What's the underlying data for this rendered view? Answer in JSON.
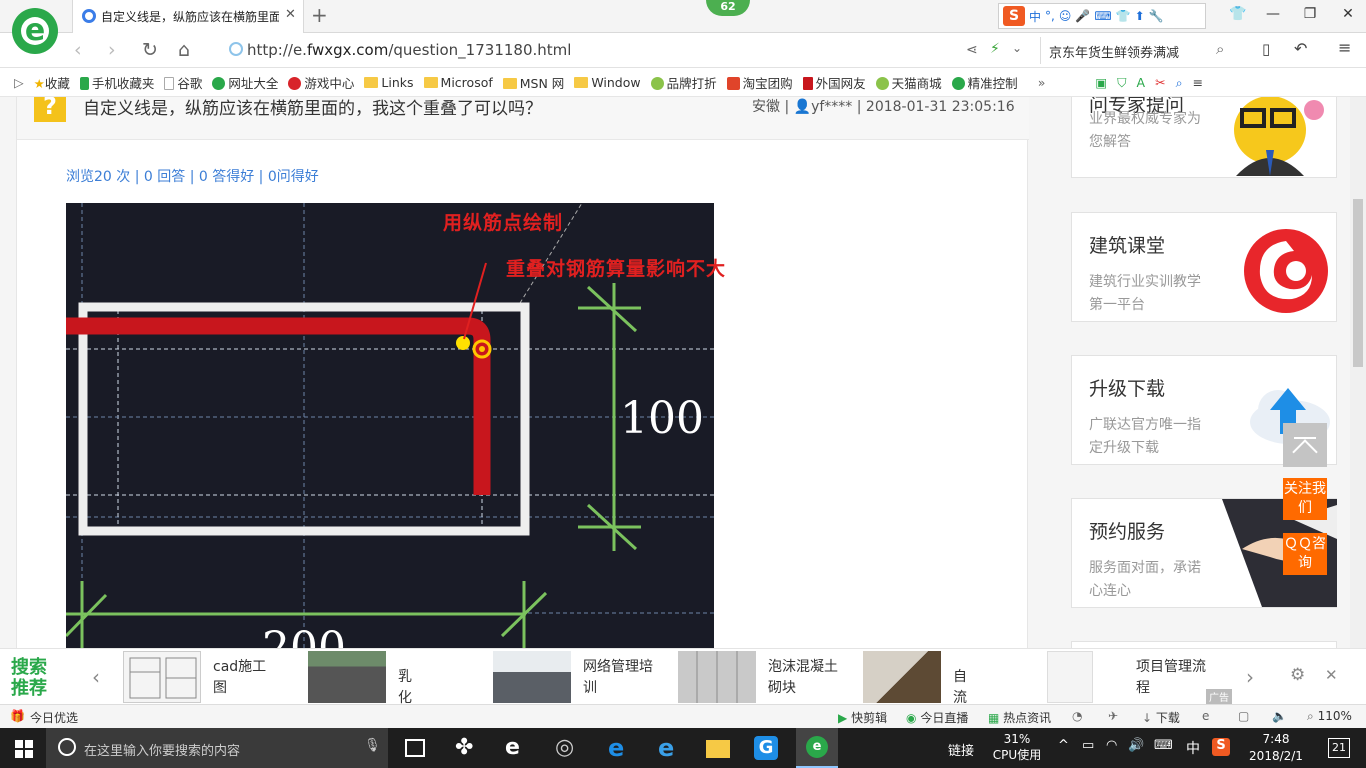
{
  "tab": {
    "title": "自定义线是，纵筋应该在横筋里面"
  },
  "badge": "62",
  "sogou": {
    "items": [
      "中",
      "°,",
      "☺",
      "🎤",
      "⌨",
      "👕",
      "⬆",
      "🔧"
    ]
  },
  "address": {
    "url_prefix": "http://e.",
    "url_domain": "fwxgx.com",
    "url_path": "/question_1731180.html",
    "search_text": "京东年货生鲜领券满减"
  },
  "bookmarks": [
    "收藏",
    "手机收藏夹",
    "谷歌",
    "网址大全",
    "游戏中心",
    "Links",
    "Microsof",
    "MSN 网",
    "Window",
    "品牌打折",
    "淘宝团购",
    "外国网友",
    "天猫商城",
    "精准控制"
  ],
  "question": {
    "icon": "?",
    "title": "自定义线是，纵筋应该在横筋里面的，我这个重叠了可以吗？",
    "meta_province": "安徽",
    "meta_user": "yf****",
    "meta_date": "2018-01-31 23:05:16",
    "stats": "浏览20 次 | 0 回答 | 0 答得好 | 0问得好"
  },
  "cad": {
    "label1": "用纵筋点绘制",
    "label2": "重叠对钢筋算量影响不大",
    "dim_value": "100",
    "dim_bottom": "200"
  },
  "cards": [
    {
      "title": "问专家提问",
      "desc": "业界最权威专家为您解答"
    },
    {
      "title": "建筑课堂",
      "desc": "建筑行业实训教学第一平台"
    },
    {
      "title": "升级下载",
      "desc": "广联达官方唯一指定升级下载"
    },
    {
      "title": "预约服务",
      "desc": "服务面对面，承诺心连心"
    }
  ],
  "side": {
    "follow": "关注我们",
    "qq": "ＱＱ咨询"
  },
  "strip": {
    "label": "搜索推荐",
    "items": [
      "cad施工图",
      "乳化沥青",
      "网络管理培训",
      "泡沫混凝土砌块",
      "自流平",
      "项目管理流程"
    ],
    "ad": "广告"
  },
  "status": {
    "left": "今日优选",
    "items": [
      "快剪辑",
      "今日直播",
      "热点资讯",
      "下载"
    ],
    "zoom": "110%"
  },
  "taskbar": {
    "search_placeholder": "在这里输入你要搜索的内容",
    "link": "链接",
    "cpu_pct": "31%",
    "cpu_label": "CPU使用",
    "ime": "中",
    "time": "7:48",
    "date": "2018/2/1",
    "notif": "21"
  },
  "colors": {
    "accent": "#2aa84a",
    "cad_bg": "#191b26",
    "rebar": "#c8161d",
    "dim": "#7bc25e"
  }
}
